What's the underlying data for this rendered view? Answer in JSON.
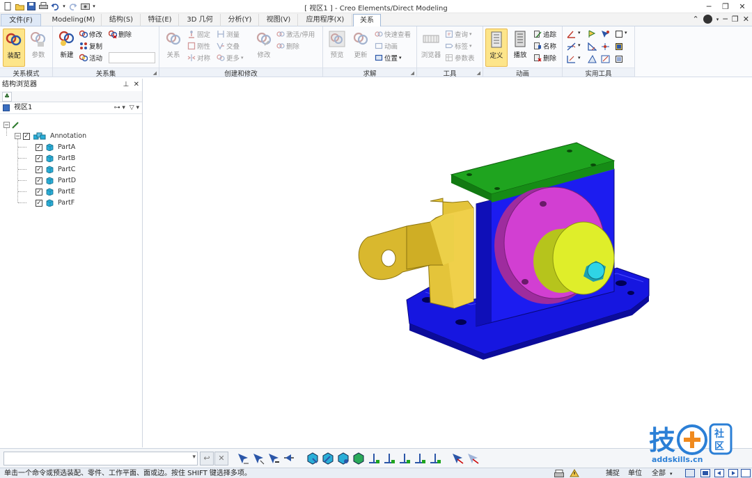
{
  "window": {
    "title": "[ 视区1 ] - Creo Elements/Direct Modeling",
    "controls": [
      "minimize-icon",
      "restore-icon",
      "close-icon"
    ]
  },
  "quick_access": [
    "new-file-icon",
    "open-folder-icon",
    "save-icon",
    "print-icon",
    "undo-icon",
    "redo-icon",
    "settings-icon"
  ],
  "tabs": [
    {
      "label": "文件(F)"
    },
    {
      "label": "Modeling(M)"
    },
    {
      "label": "结构(S)"
    },
    {
      "label": "特征(E)"
    },
    {
      "label": "3D 几何"
    },
    {
      "label": "分析(Y)"
    },
    {
      "label": "视图(V)"
    },
    {
      "label": "应用程序(X)"
    },
    {
      "label": "关系"
    }
  ],
  "active_tab": "关系",
  "ribbon": {
    "groups": {
      "relation_mode": "关系模式",
      "relation_set": "关系集",
      "create_modify": "创建和修改",
      "solve": "求解",
      "tools": "工具",
      "animation": "动画",
      "utilities": "实用工具"
    },
    "buttons": {
      "assembly": "装配",
      "parameters": "参数",
      "new": "新建",
      "modify": "修改",
      "delete": "删除",
      "copy": "复制",
      "active": "活动",
      "relation": "关系",
      "fix": "固定",
      "measure": "测量",
      "rigid": "刚性",
      "intersect": "交叠",
      "symmetric": "对称",
      "more": "更多",
      "modify2": "修改",
      "activate": "激活/停用",
      "delete2": "删除",
      "preview": "预览",
      "update": "更新",
      "quick_view": "快速查看",
      "animate": "动画",
      "position": "位置",
      "browser": "浏览器",
      "query": "查询",
      "label": "标签",
      "param_table": "参数表",
      "define": "定义",
      "play": "播放",
      "trace": "追踪",
      "name": "名称",
      "delete3": "删除"
    }
  },
  "browser": {
    "title": "结构浏览器",
    "view_label": "视区1",
    "tree": {
      "root": "Annotation",
      "parts": [
        "PartA",
        "PartB",
        "PartC",
        "PartD",
        "PartE",
        "PartF"
      ]
    }
  },
  "colors": {
    "base": "#1616e0",
    "top_plate": "#1fa41f",
    "flange": "#d23fd2",
    "hub": "#dfee2a",
    "shaft": "#2fd4e6",
    "arm": "#e4c43a",
    "part_icon": "#2aaed8"
  },
  "statusbar": {
    "message": "单击一个命令或预选装配、零件、工作平面、面或边。按住 SHIFT 键选择多项。",
    "snap": "捕捉",
    "units": "单位",
    "filter": "全部"
  },
  "watermark": {
    "brand": "技成社区",
    "url": "addskills.cn"
  }
}
